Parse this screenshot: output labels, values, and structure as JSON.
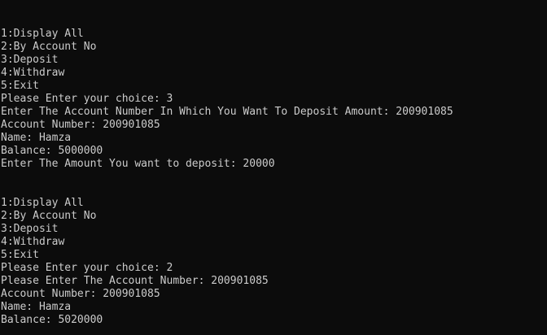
{
  "console": {
    "text_color": "#cccccc",
    "background_color": "#0c0c0c",
    "lines": [
      "1:Display All",
      "2:By Account No",
      "3:Deposit",
      "4:Withdraw",
      "5:Exit",
      "Please Enter your choice: 3",
      "Enter The Account Number In Which You Want To Deposit Amount: 200901085",
      "Account Number: 200901085",
      "Name: Hamza",
      "Balance: 5000000",
      "Enter The Amount You want to deposit: 20000",
      "",
      "",
      "1:Display All",
      "2:By Account No",
      "3:Deposit",
      "4:Withdraw",
      "5:Exit",
      "Please Enter your choice: 2",
      "Please Enter The Account Number: 200901085",
      "Account Number: 200901085",
      "Name: Hamza",
      "Balance: 5020000"
    ]
  }
}
